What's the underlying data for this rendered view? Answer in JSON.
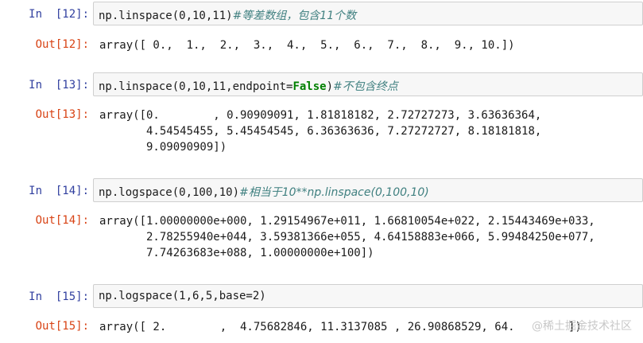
{
  "cells": [
    {
      "in_prompt": "In  [12]:",
      "code": {
        "fn": "np.linspace",
        "args": "(0,10,11)",
        "comment": "#等差数组，包含11个数"
      },
      "out_prompt": "Out[12]:",
      "output": "array([ 0.,  1.,  2.,  3.,  4.,  5.,  6.,  7.,  8.,  9., 10.])"
    },
    {
      "in_prompt": "In  [13]:",
      "code": {
        "fn": "np.linspace",
        "args_pre": "(0,10,11,endpoint=",
        "kw": "False",
        "args_post": ")",
        "comment": "#不包含终点"
      },
      "out_prompt": "Out[13]:",
      "output": "array([0.        , 0.90909091, 1.81818182, 2.72727273, 3.63636364,\n       4.54545455, 5.45454545, 6.36363636, 7.27272727, 8.18181818,\n       9.09090909])"
    },
    {
      "in_prompt": "In  [14]:",
      "code": {
        "fn": "np.logspace",
        "args": "(0,100,10)",
        "comment": "#相当于10**np.linspace(0,100,10)"
      },
      "out_prompt": "Out[14]:",
      "output": "array([1.00000000e+000, 1.29154967e+011, 1.66810054e+022, 2.15443469e+033,\n       2.78255940e+044, 3.59381366e+055, 4.64158883e+066, 5.99484250e+077,\n       7.74263683e+088, 1.00000000e+100])"
    },
    {
      "in_prompt": "In  [15]:",
      "code": {
        "fn": "np.logspace",
        "args": "(1,6,5,base=2)",
        "comment": ""
      },
      "out_prompt": "Out[15]:",
      "output": "array([ 2.        ,  4.75682846, 11.3137085 , 26.90868529, 64.        ])"
    }
  ],
  "watermark": "@稀土掘金技术社区"
}
